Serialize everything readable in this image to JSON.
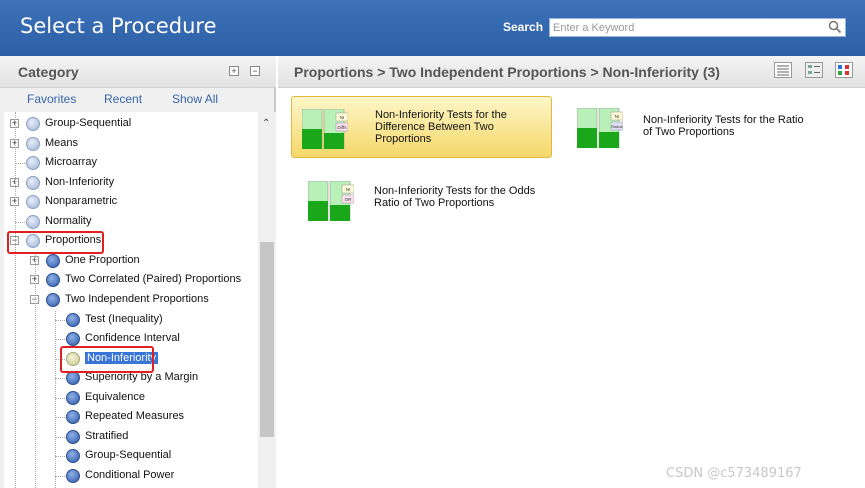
{
  "header": {
    "title": "Select a Procedure",
    "search_label": "Search",
    "search_placeholder": "Enter a Keyword",
    "colors": {
      "bar": "#3d72b8",
      "text": "#ffffff"
    }
  },
  "category": {
    "title": "Category",
    "tabs": [
      "Favorites",
      "Recent",
      "Show All"
    ]
  },
  "tree": [
    {
      "label": "Group-Sequential",
      "level": 0,
      "expander": "+",
      "icon": "light"
    },
    {
      "label": "Means",
      "level": 0,
      "expander": "+",
      "icon": "light"
    },
    {
      "label": "Microarray",
      "level": 0,
      "expander": "",
      "icon": "light"
    },
    {
      "label": "Non-Inferiority",
      "level": 0,
      "expander": "+",
      "icon": "light"
    },
    {
      "label": "Nonparametric",
      "level": 0,
      "expander": "+",
      "icon": "light"
    },
    {
      "label": "Normality",
      "level": 0,
      "expander": "",
      "icon": "light"
    },
    {
      "label": "Proportions",
      "level": 0,
      "expander": "−",
      "icon": "light"
    },
    {
      "label": "One Proportion",
      "level": 1,
      "expander": "+",
      "icon": "dark"
    },
    {
      "label": "Two Correlated (Paired) Proportions",
      "level": 1,
      "expander": "+",
      "icon": "dark"
    },
    {
      "label": "Two Independent Proportions",
      "level": 1,
      "expander": "−",
      "icon": "dark"
    },
    {
      "label": "Test (Inequality)",
      "level": 2,
      "expander": "",
      "icon": "dark"
    },
    {
      "label": "Confidence Interval",
      "level": 2,
      "expander": "",
      "icon": "dark"
    },
    {
      "label": "Non-Inferiority",
      "level": 2,
      "expander": "",
      "icon": "yellow",
      "selected": true
    },
    {
      "label": "Superiority by a Margin",
      "level": 2,
      "expander": "",
      "icon": "dark"
    },
    {
      "label": "Equivalence",
      "level": 2,
      "expander": "",
      "icon": "dark"
    },
    {
      "label": "Repeated Measures",
      "level": 2,
      "expander": "",
      "icon": "dark"
    },
    {
      "label": "Stratified",
      "level": 2,
      "expander": "",
      "icon": "dark"
    },
    {
      "label": "Group-Sequential",
      "level": 2,
      "expander": "",
      "icon": "dark"
    },
    {
      "label": "Conditional Power",
      "level": 2,
      "expander": "",
      "icon": "dark"
    }
  ],
  "breadcrumb": "Proportions > Two Independent Proportions > Non-Inferiority (3)",
  "view_icons": [
    "list-view-icon",
    "detail-view-icon",
    "chart-view-icon"
  ],
  "procedures": [
    {
      "title": "Non-Inferiority Tests for the Difference Between Two Proportions",
      "lines": [
        "Non-Inferiority Tests for the",
        "Difference Between Two",
        "Proportions"
      ],
      "tag1": "NI",
      "tag2": "Diffs",
      "highlight": true
    },
    {
      "title": "Non-Inferiority Tests for the Ratio of Two Proportions",
      "lines": [
        "Non-Inferiority Tests for the Ratio",
        "of Two Proportions"
      ],
      "tag1": "NI",
      "tag2": "Ratios",
      "highlight": false
    },
    {
      "title": "Non-Inferiority Tests for the Odds Ratio of Two Proportions",
      "lines": [
        "Non-Inferiority Tests for the Odds",
        "Ratio of Two Proportions"
      ],
      "tag1": "NI",
      "tag2": "OR",
      "highlight": false
    }
  ],
  "watermark": "CSDN @c573489167"
}
